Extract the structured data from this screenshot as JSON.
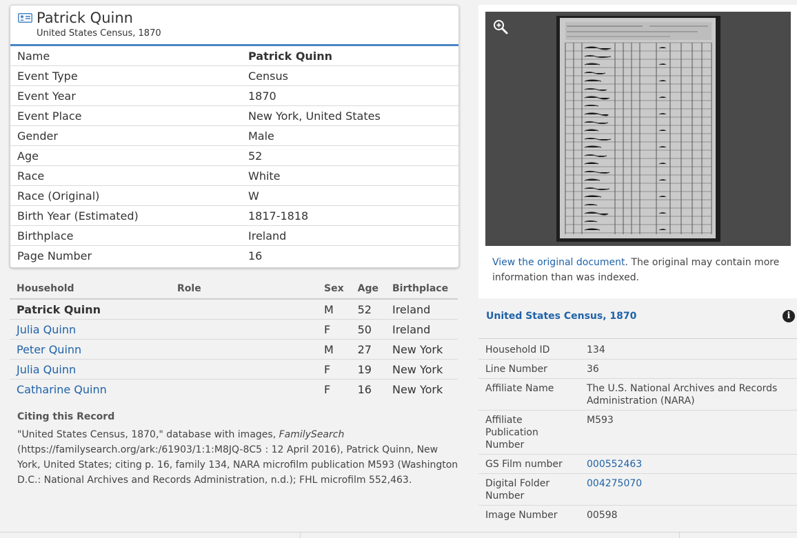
{
  "record": {
    "name": "Patrick Quinn",
    "collection": "United States Census, 1870",
    "facts": [
      {
        "label": "Name",
        "value": "Patrick Quinn"
      },
      {
        "label": "Event Type",
        "value": "Census"
      },
      {
        "label": "Event Year",
        "value": "1870"
      },
      {
        "label": "Event Place",
        "value": "New York, United States"
      },
      {
        "label": "Gender",
        "value": "Male"
      },
      {
        "label": "Age",
        "value": "52"
      },
      {
        "label": "Race",
        "value": "White"
      },
      {
        "label": "Race (Original)",
        "value": "W"
      },
      {
        "label": "Birth Year (Estimated)",
        "value": "1817-1818"
      },
      {
        "label": "Birthplace",
        "value": "Ireland"
      },
      {
        "label": "Page Number",
        "value": "16"
      }
    ]
  },
  "household": {
    "headers": {
      "name": "Household",
      "role": "Role",
      "sex": "Sex",
      "age": "Age",
      "birthplace": "Birthplace"
    },
    "members": [
      {
        "name": "Patrick Quinn",
        "role": "",
        "sex": "M",
        "age": "52",
        "birthplace": "Ireland"
      },
      {
        "name": "Julia Quinn",
        "role": "",
        "sex": "F",
        "age": "50",
        "birthplace": "Ireland"
      },
      {
        "name": "Peter Quinn",
        "role": "",
        "sex": "M",
        "age": "27",
        "birthplace": "New York"
      },
      {
        "name": "Julia Quinn",
        "role": "",
        "sex": "F",
        "age": "19",
        "birthplace": "New York"
      },
      {
        "name": "Catharine Quinn",
        "role": "",
        "sex": "F",
        "age": "16",
        "birthplace": "New York"
      }
    ]
  },
  "citation": {
    "title": "Citing this Record",
    "part1": "\"United States Census, 1870,\" database with images, ",
    "italic": "FamilySearch",
    "part2": " (https://familysearch.org/ark:/61903/1:1:M8JQ-8C5 : 12 April 2016), Patrick Quinn, New York, United States; citing p. 16, family 134, NARA microfilm publication M593 (Washington D.C.: National Archives and Records Administration, n.d.); FHL microfilm 552,463."
  },
  "viewer": {
    "link_text": "View the original document",
    "note_text": ". The original may contain more information than was indexed."
  },
  "collection_details": {
    "title": "United States Census, 1870",
    "rows": [
      {
        "label": "Household ID",
        "value": "134"
      },
      {
        "label": "Line Number",
        "value": "36"
      },
      {
        "label": "Affiliate Name",
        "value": "The U.S. National Archives and Records Administration (NARA)"
      },
      {
        "label": "Affiliate Publication Number",
        "value": "M593"
      },
      {
        "label": "GS Film number",
        "value": "000552463"
      },
      {
        "label": "Digital Folder Number",
        "value": "004275070"
      },
      {
        "label": "Image Number",
        "value": "00598"
      }
    ]
  },
  "icons": {
    "person_card": "person-card-icon",
    "zoom": "zoom-in-icon",
    "info": "info-icon"
  },
  "colors": {
    "link": "#1f62a8",
    "card_accent": "#4a86c6",
    "viewer_bg": "#4a4a4a"
  }
}
